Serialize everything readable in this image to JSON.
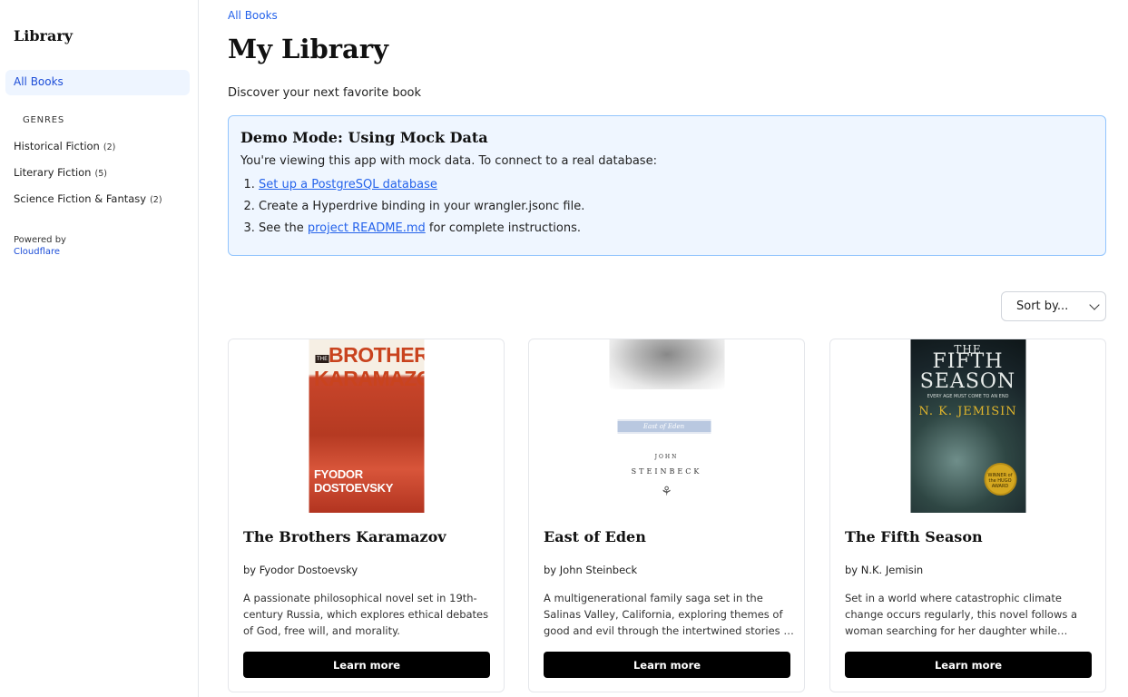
{
  "sidebar": {
    "title": "Library",
    "all_books": "All Books",
    "genres_heading": "Genres",
    "genres": [
      {
        "label": "Historical Fiction",
        "count": "(2)"
      },
      {
        "label": "Literary Fiction",
        "count": "(5)"
      },
      {
        "label": "Science Fiction & Fantasy",
        "count": "(2)"
      }
    ],
    "powered_by": "Powered by",
    "powered_link": "Cloudflare"
  },
  "main": {
    "breadcrumb": "All Books",
    "title": "My Library",
    "subtitle": "Discover your next favorite book",
    "notice": {
      "title": "Demo Mode: Using Mock Data",
      "text": "You're viewing this app with mock data. To connect to a real database:",
      "step1_link": "Set up a PostgreSQL database",
      "step2": "Create a Hyperdrive binding in your wrangler.jsonc file.",
      "step3_pre": "See the ",
      "step3_link": "project README.md",
      "step3_post": " for complete instructions."
    },
    "sort_label": "Sort by...",
    "button_label": "Learn more",
    "books": [
      {
        "title": "The Brothers Karamazov",
        "author": "by Fyodor Dostoevsky",
        "description": "A passionate philosophical novel set in 19th-century Russia, which explores ethical debates of God, free will, and morality.",
        "cover": {
          "the": "THE",
          "line1": "BROTHERS",
          "line2": "KARAMAZOV",
          "author": "FYODOR DOSTOEVSKY"
        }
      },
      {
        "title": "East of Eden",
        "author": "by John Steinbeck",
        "description": "A multigenerational family saga set in the Salinas Valley, California, exploring themes of good and evil through the intertwined stories of two families.",
        "cover": {
          "title": "East of Eden",
          "first": "JOHN",
          "last": "STEINBECK"
        }
      },
      {
        "title": "The Fifth Season",
        "author": "by N.K. Jemisin",
        "description": "Set in a world where catastrophic climate change occurs regularly, this novel follows a woman searching for her daughter while navigating a dangerous land.",
        "cover": {
          "the": "THE",
          "title": "FIFTH SEASON",
          "tagline": "EVERY AGE MUST COME TO AN END",
          "author": "N. K. JEMISIN",
          "seal": "WINNER of the HUGO AWARD"
        }
      }
    ]
  }
}
